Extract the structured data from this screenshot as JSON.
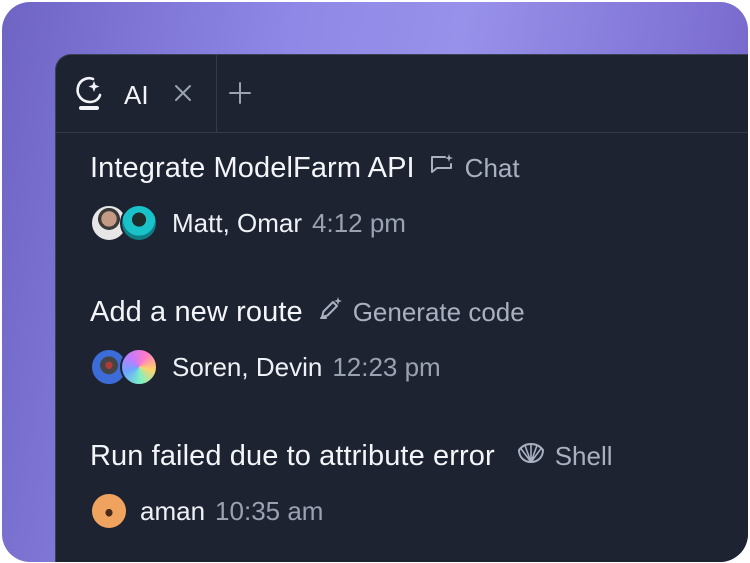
{
  "tab": {
    "icon": "ai-sparkle-icon",
    "label": "AI",
    "close_icon": "close-icon",
    "new_tab_icon": "plus-icon"
  },
  "threads": [
    {
      "title": "Integrate ModelFarm API",
      "type_label": "Chat",
      "type_icon": "chat-icon",
      "participants": "Matt, Omar",
      "time": "4:12 pm"
    },
    {
      "title": "Add a new route",
      "type_label": "Generate code",
      "type_icon": "pencil-sparkle-icon",
      "participants": "Soren, Devin",
      "time": "12:23 pm"
    },
    {
      "title": "Run failed due to attribute error",
      "type_label": "Shell",
      "type_icon": "shell-icon",
      "participants": "aman",
      "time": "10:35 am"
    }
  ],
  "colors": {
    "panel_bg": "#1d2331",
    "border": "#343b4b",
    "text_primary": "#f3f5f9",
    "text_secondary": "#9aa2b2",
    "frame_gradient_start": "#6f64c4",
    "frame_gradient_mid": "#9891ea"
  }
}
